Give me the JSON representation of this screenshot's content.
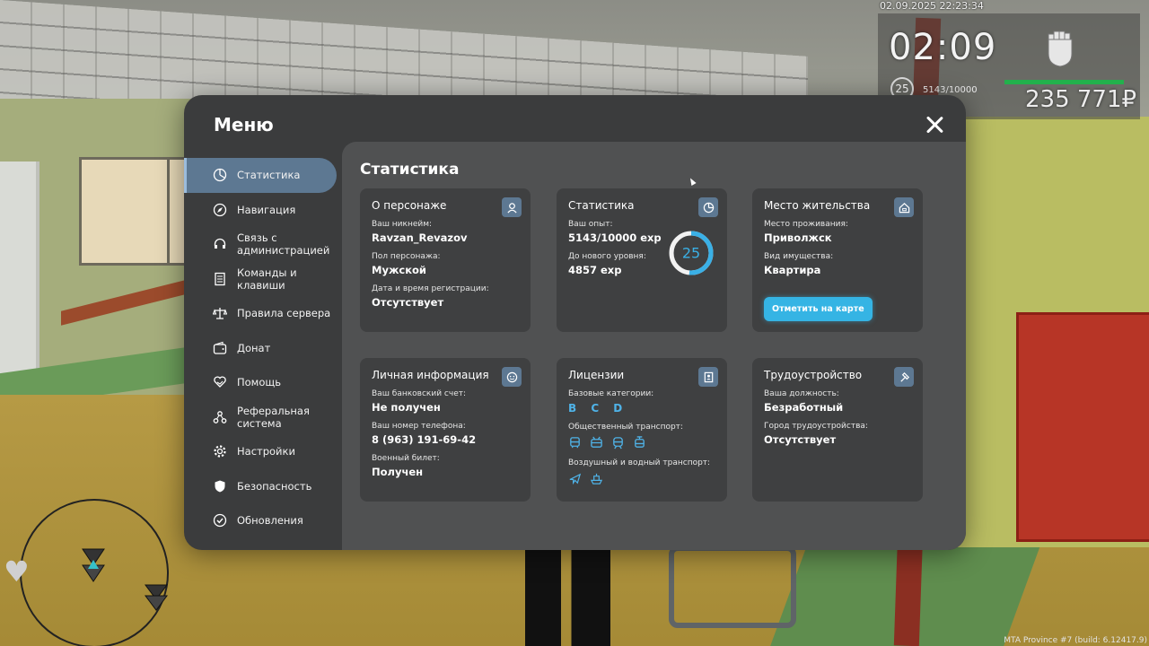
{
  "hud": {
    "datetime": "02.09.2025 22:23:34",
    "time": "02:09",
    "level": "25",
    "exp": "5143/10000",
    "money": "235 771₽",
    "build": "MTA Province #7 (build: 6.12417.9)"
  },
  "menu": {
    "title": "Меню",
    "close_icon": "close-icon",
    "sidebar": [
      {
        "label": "Статистика",
        "icon": "pie-chart-icon",
        "active": true
      },
      {
        "label": "Навигация",
        "icon": "compass-icon",
        "active": false
      },
      {
        "label": "Связь с\nадминистрацией",
        "icon": "headset-icon",
        "active": false
      },
      {
        "label": "Команды и\nклавиши",
        "icon": "document-icon",
        "active": false
      },
      {
        "label": "Правила сервера",
        "icon": "scales-icon",
        "active": false
      },
      {
        "label": "Донат",
        "icon": "wallet-icon",
        "active": false
      },
      {
        "label": "Помощь",
        "icon": "heart-hand-icon",
        "active": false
      },
      {
        "label": "Реферальная\nсистема",
        "icon": "network-icon",
        "active": false
      },
      {
        "label": "Настройки",
        "icon": "gear-icon",
        "active": false
      },
      {
        "label": "Безопасность",
        "icon": "shield-icon",
        "active": false
      },
      {
        "label": "Обновления",
        "icon": "check-circle-icon",
        "active": false
      }
    ],
    "content_title": "Статистика",
    "cards": {
      "character": {
        "title": "О персонаже",
        "icon": "user-icon",
        "nickname_label": "Ваш никнейм:",
        "nickname": "Ravzan_Revazov",
        "gender_label": "Пол персонажа:",
        "gender": "Мужской",
        "reg_label": "Дата и время регистрации:",
        "reg": "Отсутствует"
      },
      "stats": {
        "title": "Статистика",
        "icon": "pie-chart-icon",
        "exp_label": "Ваш опыт:",
        "exp": "5143/10000 exp",
        "next_label": "До нового уровня:",
        "next": "4857 exp",
        "level": "25",
        "progress": 0.5143,
        "ring_color": "#3ab0e6"
      },
      "residence": {
        "title": "Место жительства",
        "icon": "house-icon",
        "place_label": "Место проживания:",
        "place": "Приволжск",
        "property_label": "Вид имущества:",
        "property": "Квартира",
        "map_button": "Отметить на карте"
      },
      "personal": {
        "title": "Личная информация",
        "icon": "smile-icon",
        "bank_label": "Ваш банковский счет:",
        "bank": "Не получен",
        "phone_label": "Ваш номер телефона:",
        "phone": "8 (963) 191-69-42",
        "military_label": "Военный билет:",
        "military": "Получен"
      },
      "licenses": {
        "title": "Лицензии",
        "icon": "id-card-icon",
        "basic_label": "Базовые категории:",
        "basic": "B C D",
        "public_label": "Общественный транспорт:",
        "public_icons": [
          "bus-icon",
          "trolleybus-icon",
          "train-icon",
          "tram-icon"
        ],
        "air_label": "Воздушный и водный транспорт:",
        "air_icons": [
          "plane-icon",
          "boat-icon"
        ]
      },
      "employment": {
        "title": "Трудоустройство",
        "icon": "hammer-icon",
        "position_label": "Ваша должность:",
        "position": "Безработный",
        "city_label": "Город трудоустройства:",
        "city": "Отсутствует"
      }
    }
  },
  "colors": {
    "accent": "#35b4e4",
    "active_nav": "#5d7892",
    "menu_bg": "#3b3c3d",
    "content_bg": "#505152",
    "card_bg": "#3f4041"
  }
}
